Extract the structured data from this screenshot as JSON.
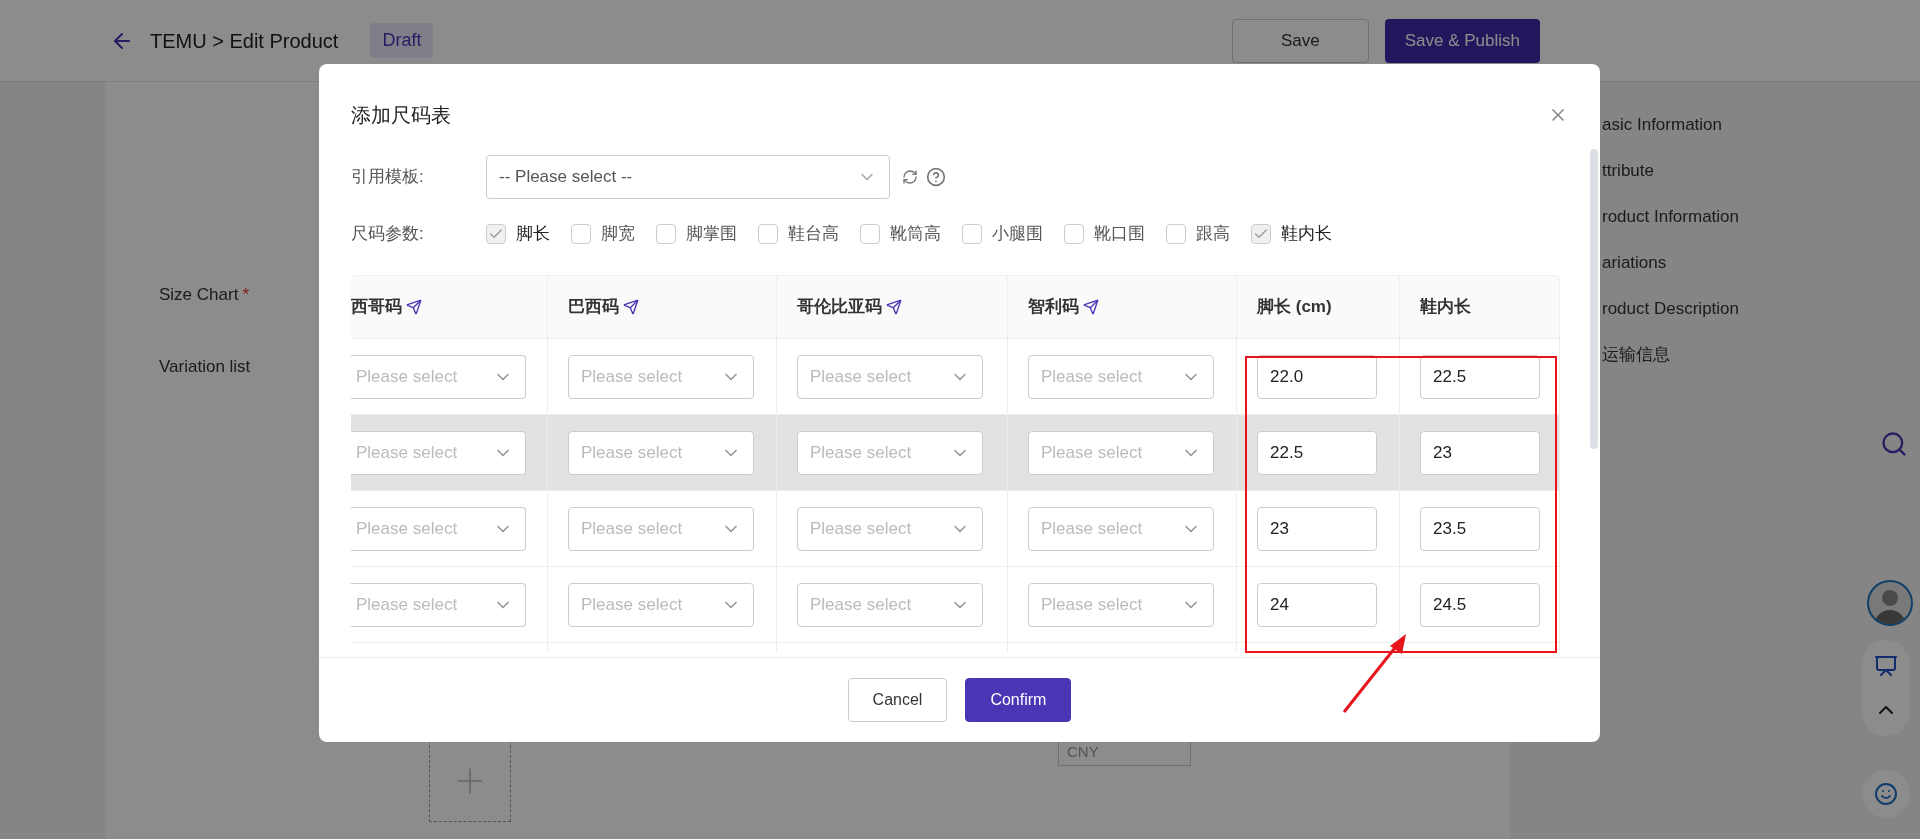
{
  "header": {
    "breadcrumb": "TEMU > Edit Product",
    "status_badge": "Draft",
    "buttons": [
      {
        "label": "Save",
        "kind": "secondary"
      },
      {
        "label": "Save & Publish",
        "kind": "primary"
      }
    ]
  },
  "form": {
    "labels": [
      {
        "text": "Size Chart",
        "required_mark": "*"
      },
      {
        "text": "Variation list"
      }
    ],
    "price_field": {
      "value": "CNY"
    }
  },
  "side_nav": {
    "items": [
      "asic Information",
      "ttribute",
      "roduct Information",
      "ariations",
      "roduct Description",
      "运输信息"
    ]
  },
  "modal": {
    "title": "添加尺码表",
    "template": {
      "label": "引用模板:",
      "placeholder": "-- Please select --"
    },
    "params": {
      "label": "尺码参数:",
      "options": [
        {
          "label": "脚长",
          "checked": true
        },
        {
          "label": "脚宽",
          "checked": false
        },
        {
          "label": "脚掌围",
          "checked": false
        },
        {
          "label": "鞋台高",
          "checked": false
        },
        {
          "label": "靴筒高",
          "checked": false
        },
        {
          "label": "小腿围",
          "checked": false
        },
        {
          "label": "靴口围",
          "checked": false
        },
        {
          "label": "跟高",
          "checked": false
        },
        {
          "label": "鞋内长",
          "checked": true
        }
      ]
    },
    "table": {
      "columns": [
        {
          "label": "西哥码",
          "kind": "region"
        },
        {
          "label": "巴西码",
          "kind": "region"
        },
        {
          "label": "哥伦比亚码",
          "kind": "region"
        },
        {
          "label": "智利码",
          "kind": "region"
        },
        {
          "label": "脚长 (cm)",
          "kind": "measure"
        },
        {
          "label": "鞋内长",
          "kind": "measure"
        }
      ],
      "rows": [
        {
          "hovered": false,
          "cells": [
            "Please select",
            "Please select",
            "Please select",
            "Please select",
            "22.0",
            "22.5"
          ]
        },
        {
          "hovered": true,
          "cells": [
            "Please select",
            "Please select",
            "Please select",
            "Please select",
            "22.5",
            "23"
          ]
        },
        {
          "hovered": false,
          "cells": [
            "Please select",
            "Please select",
            "Please select",
            "Please select",
            "23",
            "23.5"
          ]
        },
        {
          "hovered": false,
          "cells": [
            "Please select",
            "Please select",
            "Please select",
            "Please select",
            "24",
            "24.5"
          ]
        }
      ]
    },
    "footer": {
      "buttons": [
        {
          "label": "Cancel",
          "kind": "secondary"
        },
        {
          "label": "Confirm",
          "kind": "primary"
        }
      ]
    }
  }
}
